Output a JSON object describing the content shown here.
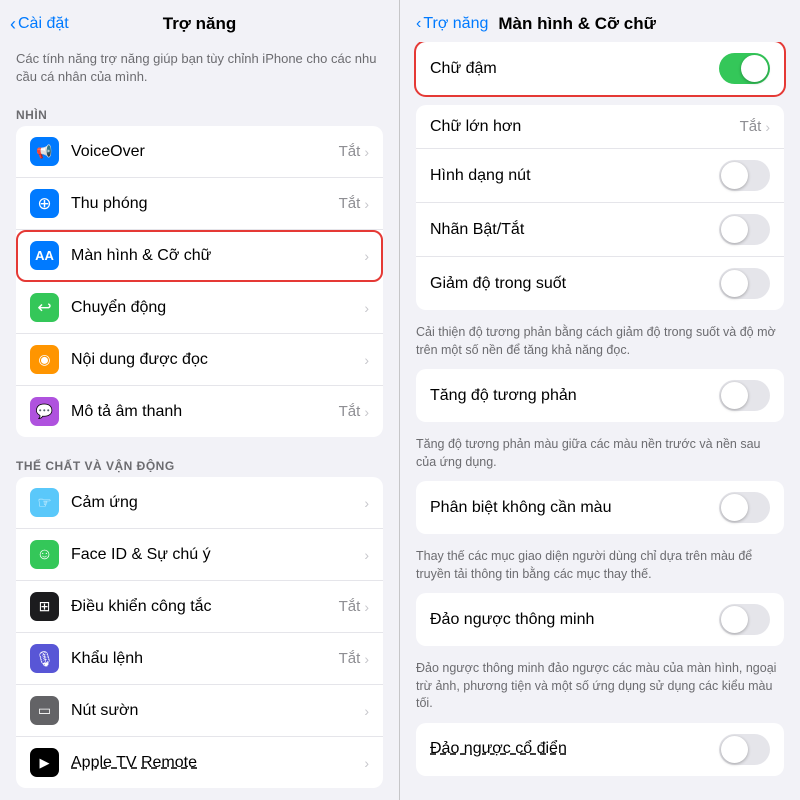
{
  "left": {
    "back_label": "Cài đặt",
    "title": "Trợ năng",
    "description": "Các tính năng trợ năng giúp bạn tùy chỉnh iPhone cho các nhu cầu cá nhân của mình.",
    "section_nhin": "NHÌN",
    "section_the_chat": "THỂ CHẤT VÀ VẬN ĐỘNG",
    "rows_nhin": [
      {
        "id": "voiceover",
        "icon": "🔊",
        "icon_color": "icon-blue",
        "label": "VoiceOver",
        "value": "Tắt",
        "has_chevron": true
      },
      {
        "id": "thu-phong",
        "icon": "⊕",
        "icon_color": "icon-blue",
        "label": "Thu phóng",
        "value": "Tắt",
        "has_chevron": true
      },
      {
        "id": "man-hinh",
        "icon": "AA",
        "icon_color": "icon-aa",
        "label": "Màn hình & Cỡ chữ",
        "value": "",
        "has_chevron": true,
        "highlighted": true
      },
      {
        "id": "chuyen-dong",
        "icon": "↩",
        "icon_color": "icon-green",
        "label": "Chuyển động",
        "value": "",
        "has_chevron": true
      },
      {
        "id": "noi-dung",
        "icon": "◉",
        "icon_color": "icon-orange",
        "label": "Nội dung được đọc",
        "value": "",
        "has_chevron": true
      },
      {
        "id": "mo-ta",
        "icon": "💬",
        "icon_color": "icon-purple",
        "label": "Mô tả âm thanh",
        "value": "Tắt",
        "has_chevron": true
      }
    ],
    "rows_the_chat": [
      {
        "id": "cam-ung",
        "icon": "👆",
        "icon_color": "icon-teal",
        "label": "Cảm ứng",
        "value": "",
        "has_chevron": true
      },
      {
        "id": "face-id",
        "icon": "☺",
        "icon_color": "icon-face",
        "label": "Face ID & Sự chú ý",
        "value": "",
        "has_chevron": true
      },
      {
        "id": "dieu-khien",
        "icon": "⊞",
        "icon_color": "icon-grid",
        "label": "Điều khiển công tắc",
        "value": "Tắt",
        "has_chevron": true
      },
      {
        "id": "khau-lenh",
        "icon": "🎙",
        "icon_color": "icon-indigo",
        "label": "Khẩu lệnh",
        "value": "Tắt",
        "has_chevron": true
      },
      {
        "id": "nut-suon",
        "icon": "⊟",
        "icon_color": "icon-side",
        "label": "Nút sườn",
        "value": "",
        "has_chevron": true
      },
      {
        "id": "apple-tv",
        "icon": "⬛",
        "icon_color": "icon-tv",
        "label": "Apple TV Remote",
        "value": "",
        "has_chevron": true
      }
    ]
  },
  "right": {
    "back_label": "Trợ năng",
    "title": "Màn hình & Cỡ chữ",
    "rows": [
      {
        "id": "chu-dam",
        "label": "Chữ đậm",
        "toggle": true,
        "toggle_on": true,
        "highlighted": true
      },
      {
        "id": "chu-lon",
        "label": "Chữ lớn hơn",
        "value": "Tắt",
        "has_chevron": true
      },
      {
        "id": "hinh-dang",
        "label": "Hình dạng nút",
        "toggle": true,
        "toggle_on": false
      },
      {
        "id": "nhan-bat-tat",
        "label": "Nhãn Bật/Tắt",
        "toggle": true,
        "toggle_on": false
      },
      {
        "id": "giam-do",
        "label": "Giảm độ trong suốt",
        "toggle": true,
        "toggle_on": false
      }
    ],
    "giam_do_desc": "Cải thiện độ tương phản bằng cách giảm độ trong suốt và độ mờ trên một số nền để tăng khả năng đọc.",
    "rows2": [
      {
        "id": "tang-do",
        "label": "Tăng độ tương phản",
        "toggle": true,
        "toggle_on": false
      }
    ],
    "tang_do_desc": "Tăng độ tương phản màu giữa các màu nền trước và nền sau của ứng dụng.",
    "rows3": [
      {
        "id": "phan-biet",
        "label": "Phân biệt không cần màu",
        "toggle": true,
        "toggle_on": false
      }
    ],
    "phan_biet_desc": "Thay thế các mục giao diện người dùng chỉ dựa trên màu để truyền tải thông tin bằng các mục thay thế.",
    "rows4": [
      {
        "id": "dao-nguoc",
        "label": "Đảo ngược thông minh",
        "toggle": true,
        "toggle_on": false
      }
    ],
    "dao_nguoc_desc": "Đảo ngược thông minh đảo ngược các màu của màn hình, ngoại trừ ảnh, phương tiện và một số ứng dụng sử dụng các kiểu màu tối.",
    "rows5": [
      {
        "id": "dao-nguoc-cd",
        "label": "Đảo ngược cổ điển",
        "toggle": true,
        "toggle_on": false
      }
    ]
  }
}
